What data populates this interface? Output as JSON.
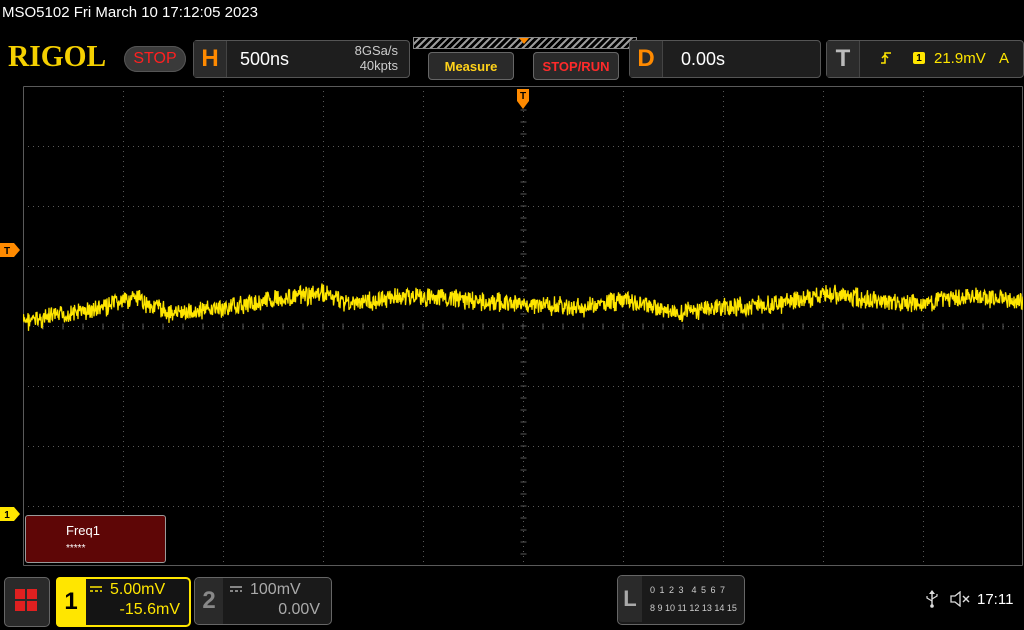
{
  "title": "MSO5102  Fri March 10 17:12:05 2023",
  "logo": "RIGOL",
  "status": {
    "label": "STOP"
  },
  "horizontal": {
    "letter": "H",
    "timebase": "500ns",
    "sample_rate": "8GSa/s",
    "memory_depth": "40kpts"
  },
  "buttons": {
    "measure": "Measure",
    "stop_run": "STOP/RUN"
  },
  "delay": {
    "letter": "D",
    "value": "0.00s"
  },
  "trigger": {
    "letter": "T",
    "source": "1",
    "level": "21.9mV",
    "mode": "A",
    "marker_label": "T",
    "edge_icon": "rising-edge-icon"
  },
  "markers": {
    "trig_pos": "T",
    "ch1": "1"
  },
  "measurement": {
    "label": "Freq1",
    "value": "*****"
  },
  "channels": [
    {
      "number": "1",
      "scale": "5.00mV",
      "offset": "-15.6mV",
      "active": true,
      "color": "#ffe600"
    },
    {
      "number": "2",
      "scale": "100mV",
      "offset": "0.00V",
      "active": false,
      "color": "#aaaaaa"
    }
  ],
  "logic": {
    "letter": "L",
    "row1": "0 1 2 3  4 5 6 7",
    "row2": "8 9 10 11 12 13 14 15"
  },
  "system": {
    "time": "17:11",
    "usb_icon": "usb-icon",
    "speaker_icon": "speaker-muted-icon"
  },
  "colors": {
    "trace": "#ffe600",
    "accent": "#ff8a00",
    "stop": "#ff2020",
    "grid": "#5a5a5a"
  }
}
